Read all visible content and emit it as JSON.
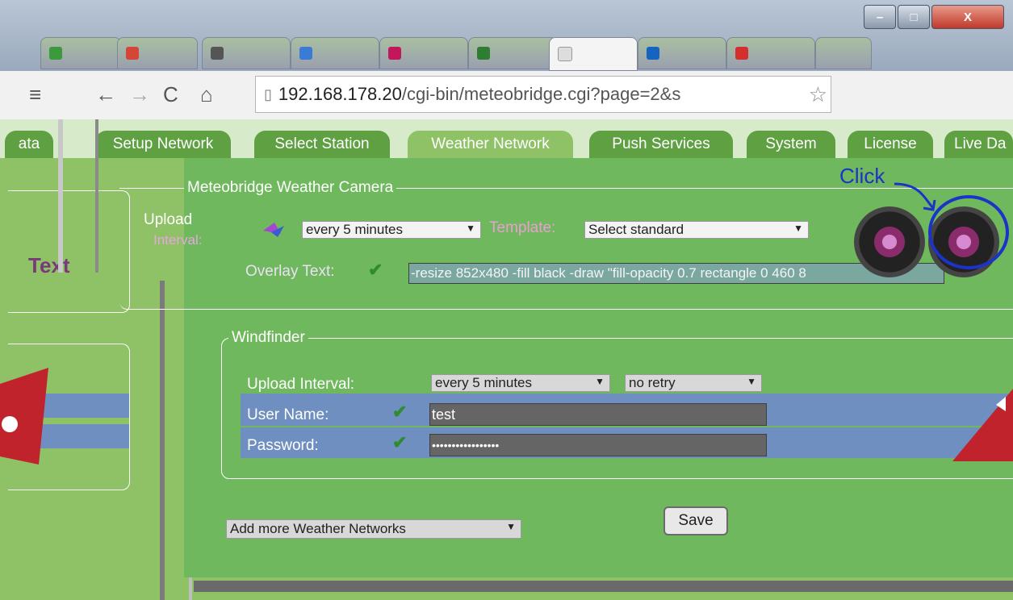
{
  "browser": {
    "url_host": "192.168.178.20",
    "url_path": "/cgi-bin/meteobridge.cgi?page=2&s"
  },
  "page_tabs": [
    {
      "label": "ata"
    },
    {
      "label": "Setup Network"
    },
    {
      "label": "Select Station"
    },
    {
      "label": "Weather Network"
    },
    {
      "label": "Push Services"
    },
    {
      "label": "System"
    },
    {
      "label": "License"
    },
    {
      "label": "Live Da"
    }
  ],
  "camera": {
    "legend": "Meteobridge Weather Camera",
    "upload_label": "Upload",
    "interval_label": "Interval:",
    "interval_value": "every 5 minutes",
    "template_label": "Template:",
    "template_value": "Select standard",
    "overlay_label": "Overlay Text:",
    "overlay_value": "-resize 852x480 -fill black -draw \"fill-opacity 0.7 rectangle 0 460 8"
  },
  "left_fragment": {
    "text": "Text"
  },
  "windfinder": {
    "legend": "Windfinder",
    "upload_label": "Upload Interval:",
    "interval_value": "every 5 minutes",
    "retry_value": "no retry",
    "user_label": "User Name:",
    "user_value": "test",
    "password_label": "Password:",
    "password_value": "•••••••••••••••••"
  },
  "add_networks": {
    "value": "Add more Weather Networks"
  },
  "save_label": "Save",
  "annotation": {
    "text": "Click"
  },
  "window_buttons": {
    "minimize": "–",
    "maximize": "□",
    "close": "X"
  },
  "colors": {
    "page_green": "#8fc267",
    "tab_green": "#5ea042",
    "annotation_blue": "#1b33c8"
  }
}
